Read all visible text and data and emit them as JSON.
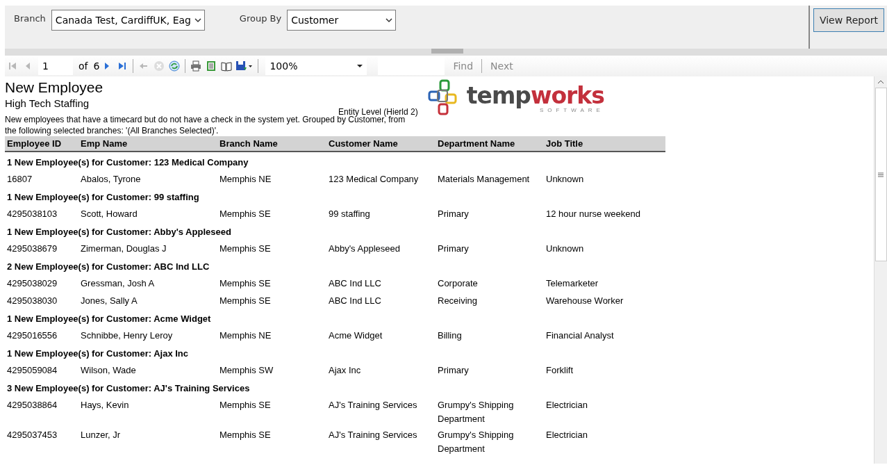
{
  "parameters": {
    "branch": {
      "label": "Branch",
      "value": "Canada Test, CardiffUK, Eag"
    },
    "group_by": {
      "label": "Group By",
      "value": "Customer"
    },
    "view_button": "View Report"
  },
  "toolbar": {
    "first": {
      "disabled": true
    },
    "previous": {
      "disabled": true
    },
    "page": "1",
    "of_label": "of",
    "page_count": "6",
    "next": {
      "disabled": false
    },
    "last": {
      "disabled": false
    },
    "back": {
      "disabled": true
    },
    "stop": {
      "disabled": true
    },
    "zoom": "100%",
    "find": "Find",
    "next_match": "Next"
  },
  "report": {
    "title": "New Employee",
    "company": "High Tech Staffing",
    "entity_level": "Entity Level (Hierld 2)",
    "logo": {
      "word_dark": "temp",
      "word_red": "works",
      "tagline": "SOFTWARE"
    },
    "description": "New employees that have a timecard but do not have a check in the system yet.  Grouped by Customer, from the following selected branches: '(All Branches Selected)'.",
    "columns": [
      "Employee ID",
      "Emp Name",
      "Branch Name",
      "Customer Name",
      "Department Name",
      "Job Title"
    ],
    "groups": [
      {
        "header": "1 New Employee(s) for Customer: 123 Medical Company",
        "rows": [
          [
            "16807",
            "Abalos, Tyrone",
            "Memphis NE",
            "123 Medical Company",
            "Materials Management",
            "Unknown"
          ]
        ]
      },
      {
        "header": "1 New Employee(s) for Customer: 99 staffing",
        "rows": [
          [
            "4295038103",
            "Scott, Howard",
            "Memphis SE",
            "99 staffing",
            "Primary",
            "12 hour nurse weekend"
          ]
        ]
      },
      {
        "header": "1 New Employee(s) for Customer: Abby's Appleseed",
        "rows": [
          [
            "4295038679",
            "Zimerman, Douglas J",
            "Memphis SE",
            "Abby's Appleseed",
            "Primary",
            "Unknown"
          ]
        ]
      },
      {
        "header": "2 New Employee(s) for Customer: ABC Ind LLC",
        "rows": [
          [
            "4295038029",
            "Gressman, Josh A",
            "Memphis SE",
            "ABC Ind LLC",
            "Corporate",
            "Telemarketer"
          ],
          [
            "4295038030",
            "Jones, Sally A",
            "Memphis SE",
            "ABC Ind LLC",
            "Receiving",
            "Warehouse Worker"
          ]
        ]
      },
      {
        "header": "1 New Employee(s) for Customer: Acme Widget",
        "rows": [
          [
            "4295016556",
            "Schnibbe, Henry Leroy",
            "Memphis NE",
            "Acme Widget",
            "Billing",
            "Financial Analyst"
          ]
        ]
      },
      {
        "header": "1 New Employee(s) for Customer: Ajax Inc",
        "rows": [
          [
            "4295059084",
            "Wilson, Wade",
            "Memphis SW",
            "Ajax Inc",
            "Primary",
            "Forklift"
          ]
        ]
      },
      {
        "header": "3 New Employee(s) for Customer: AJ's Training Services",
        "rows": [
          [
            "4295038864",
            "Hays, Kevin",
            "Memphis SE",
            "AJ's Training Services",
            "Grumpy's Shipping Department",
            "Electrician"
          ],
          [
            "4295037453",
            "Lunzer, Jr",
            "Memphis SE",
            "AJ's Training Services",
            "Grumpy's Shipping Department",
            "Electrician"
          ]
        ]
      }
    ]
  }
}
